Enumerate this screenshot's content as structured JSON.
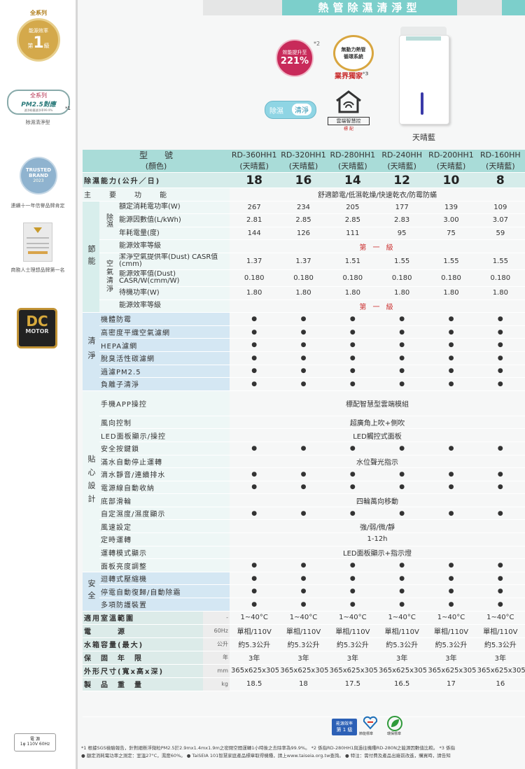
{
  "header": {
    "title": "熱管除濕清淨型"
  },
  "sidebar": {
    "badge1": {
      "top": "全系列",
      "mid": "能源效率",
      "bottom": "第",
      "num": "1",
      "suffix": "級"
    },
    "badge2": {
      "line1": "全系列",
      "line2": "PM2.5對應",
      "line3": "濾淨粉塵濾淨率99.9%",
      "note": "*1",
      "caption": "除濕清淨型"
    },
    "badge3": {
      "line1": "TRUSTED",
      "line2": "BRAND",
      "line3": "2023",
      "caption": "連續十一年信譽品牌肯定"
    },
    "badge4": {
      "caption": "商務人士理想品牌第一名"
    },
    "badge5": {
      "line1": "DC",
      "line2": "MOTOR"
    },
    "power": {
      "label": "電 源",
      "value": "1φ 110V 60Hz"
    }
  },
  "features": {
    "efficiency": {
      "line1": "效能提升至",
      "line2": "221%",
      "note": "*2"
    },
    "heatpipe": {
      "line1": "無動力熱管",
      "line2": "循環系統"
    },
    "exclusive": {
      "text": "業界獨家",
      "note": "*3"
    },
    "modes": {
      "a": "除濕",
      "b": "清淨"
    },
    "cloud": {
      "line1": "雲端智慧控",
      "line2": "標 配"
    },
    "color_label": "天晴藍"
  },
  "table": {
    "model_header": "型　　號",
    "color_header": "(顏色)",
    "models": [
      {
        "name": "RD-360HH1",
        "color": "(天晴藍)"
      },
      {
        "name": "RD-320HH1",
        "color": "(天晴藍)"
      },
      {
        "name": "RD-280HH1",
        "color": "(天晴藍)"
      },
      {
        "name": "RD-240HH",
        "color": "(天晴藍)"
      },
      {
        "name": "RD-200HH1",
        "color": "(天晴藍)"
      },
      {
        "name": "RD-160HH",
        "color": "(天晴藍)"
      }
    ],
    "capacity_label": "除濕能力(公升／日)",
    "capacity": [
      "18",
      "16",
      "14",
      "12",
      "10",
      "8"
    ],
    "main_function_label": "主　　要　　功　　能",
    "main_function": "舒適節電/低濕乾燥/快速乾衣/防霉防蟎",
    "energy_group": "節能",
    "dehum_sub": "除濕",
    "clean_sub": "空氣清淨",
    "rated_power": {
      "label": "額定消耗電功率(W)",
      "values": [
        "267",
        "234",
        "205",
        "177",
        "139",
        "109"
      ]
    },
    "energy_factor": {
      "label": "能源因數值(L/kWh)",
      "values": [
        "2.81",
        "2.85",
        "2.85",
        "2.83",
        "3.00",
        "3.07"
      ]
    },
    "annual_power": {
      "label": "年耗電量(度)",
      "values": [
        "144",
        "126",
        "111",
        "95",
        "75",
        "59"
      ]
    },
    "energy_grade": {
      "label": "能源效率等級",
      "value": "第 一 級"
    },
    "casr": {
      "label": "潔淨空氣提供率(Dust) CASR值(cmm)",
      "values": [
        "1.37",
        "1.37",
        "1.51",
        "1.55",
        "1.55",
        "1.55"
      ]
    },
    "casr_w": {
      "label": "能源效率值(Dust) CASR/W(cmm/W)",
      "values": [
        "0.180",
        "0.180",
        "0.180",
        "0.180",
        "0.180",
        "0.180"
      ]
    },
    "standby": {
      "label": "待機功率(W)",
      "values": [
        "1.80",
        "1.80",
        "1.80",
        "1.80",
        "1.80",
        "1.80"
      ]
    },
    "clean_grade": {
      "label": "能源效率等級",
      "value": "第 一 級"
    },
    "clean_group": "清淨",
    "clean_items": [
      "機體防霉",
      "高密度平織空氣濾網",
      "HEPA濾網",
      "脫臭活性碳濾網",
      "過濾PM2.5",
      "負離子清淨"
    ],
    "design_group": "貼心設計",
    "app": {
      "label": "手機APP操控",
      "value": "標配智慧型雲端模組"
    },
    "wind_direction": {
      "label": "風向控制",
      "value": "超廣角上吹+側吹"
    },
    "led_panel": {
      "label": "LED面板顯示/操控",
      "value": "LED觸控式面板"
    },
    "design_dots": [
      "安全按鍵鎖"
    ],
    "full_water": {
      "label": "滿水自動停止運轉",
      "value": "水位聲光指示"
    },
    "drain": "滴水靜音/連續排水",
    "cord": "電源線自動收納",
    "wheels": {
      "label": "底部滑輪",
      "value": "四輪萬向移動"
    },
    "humidity_display": "自定濕度/濕度顯示",
    "fan_speed": {
      "label": "風速設定",
      "value": "強/弱/微/靜"
    },
    "timer": {
      "label": "定時運轉",
      "value": "1-12h"
    },
    "mode_display": {
      "label": "運轉模式顯示",
      "value": "LED面板顯示+指示燈"
    },
    "brightness": "面板亮度調整",
    "safety_group": "安全",
    "safety_items": [
      "迴轉式壓縮機",
      "停電自動復歸/自動除霜",
      "多項防護裝置"
    ],
    "dot": "●",
    "temp_range": {
      "label": "適用室溫範圍",
      "unit": "-",
      "values": [
        "1~40°C",
        "1~40°C",
        "1~40°C",
        "1~40°C",
        "1~40°C",
        "1~40°C"
      ]
    },
    "power_src": {
      "label": "電　　　源",
      "unit": "60Hz",
      "values": [
        "單相/110V",
        "單相/110V",
        "單相/110V",
        "單相/110V",
        "單相/110V",
        "單相/110V"
      ]
    },
    "tank": {
      "label": "水箱容量(最大)",
      "unit": "公升",
      "values": [
        "約5.3公升",
        "約5.3公升",
        "約5.3公升",
        "約5.3公升",
        "約5.3公升",
        "約5.3公升"
      ]
    },
    "warranty": {
      "label": "保　固　年　限",
      "unit": "年",
      "values": [
        "3年",
        "3年",
        "3年",
        "3年",
        "3年",
        "3年"
      ]
    },
    "dimensions": {
      "label": "外形尺寸(寬x高x深)",
      "unit": "mm",
      "values": [
        "365x625x305",
        "365x625x305",
        "365x625x305",
        "365x625x305",
        "365x625x305",
        "365x625x305"
      ]
    },
    "weight": {
      "label": "製　品　重　量",
      "unit": "kg",
      "values": [
        "18.5",
        "18",
        "17.5",
        "16.5",
        "17",
        "16"
      ]
    },
    "labels": {
      "energy": "能源效率",
      "energy_grade": "第 1 級",
      "saving": "節能標章",
      "eco": "環保標章"
    }
  },
  "footnotes": {
    "line1": "*1 根據SGS檢驗報告，針對細懸浮微粒PM2.5於2.9mx1.4mx1.9m之密閉空間運轉1小時後之去除率為99.9%。 *2 係指RD-280HH1與過往機種RD-280N之能源因數值比較。 *3 係指",
    "line2": "● 額定消耗電功率之測定：室溫27°C，濕度60%。 ● TaiSEIA 101智慧家庭產品標章取得機種，請上www.taiseia.org.tw查詢。 ● 特注：需付費及產品出廠前改進，購買時，請告知"
  }
}
